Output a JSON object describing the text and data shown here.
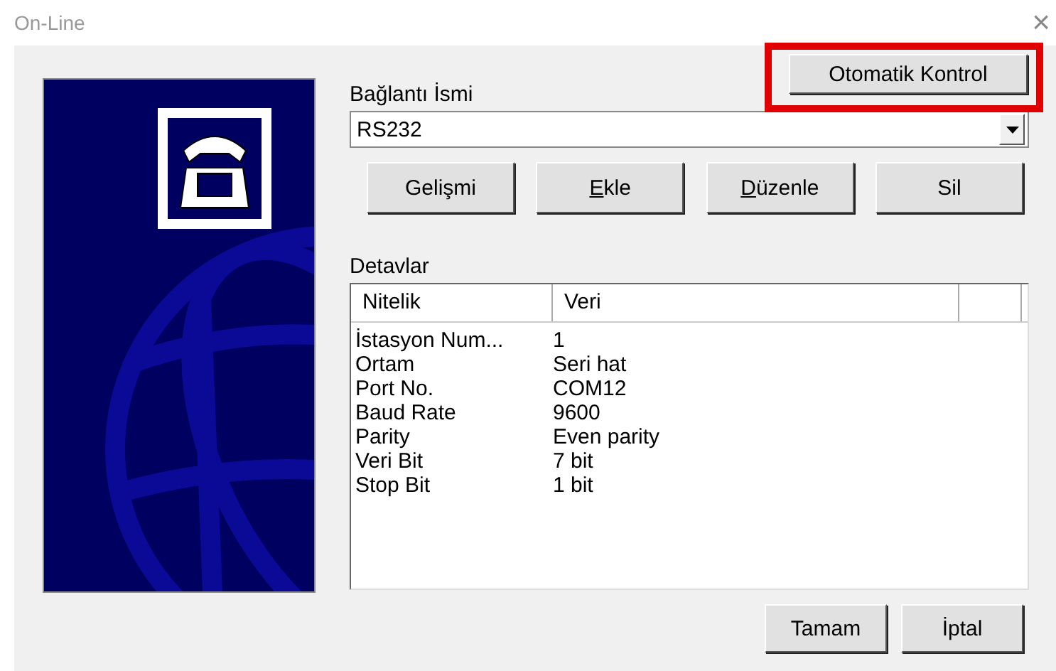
{
  "window": {
    "title": "On-Line",
    "close": "×"
  },
  "auto_button": {
    "label": "Otomatik Kontrol",
    "highlighted": true
  },
  "connection": {
    "label": "Bağlantı İsmi",
    "value": "RS232"
  },
  "actions": [
    {
      "label": "Gelişmi",
      "access_key": false
    },
    {
      "label": "Ekle",
      "access_key": true
    },
    {
      "label": "Düzenle",
      "access_key": true
    },
    {
      "label": "Sil",
      "access_key": false
    }
  ],
  "details": {
    "label": "Detavlar",
    "columns": [
      "Nitelik",
      "Veri"
    ],
    "rows": [
      [
        "İstasyon Num...",
        "1"
      ],
      [
        "Ortam",
        "Seri hat"
      ],
      [
        "Port No.",
        "COM12"
      ],
      [
        "Baud Rate",
        "9600"
      ],
      [
        "Parity",
        "Even parity"
      ],
      [
        "Veri Bit",
        "7 bit"
      ],
      [
        "Stop Bit",
        "1 bit"
      ]
    ]
  },
  "buttons": [
    {
      "label": "Tamam",
      "access_key": false
    },
    {
      "label": "İptal",
      "access_key": false
    }
  ]
}
